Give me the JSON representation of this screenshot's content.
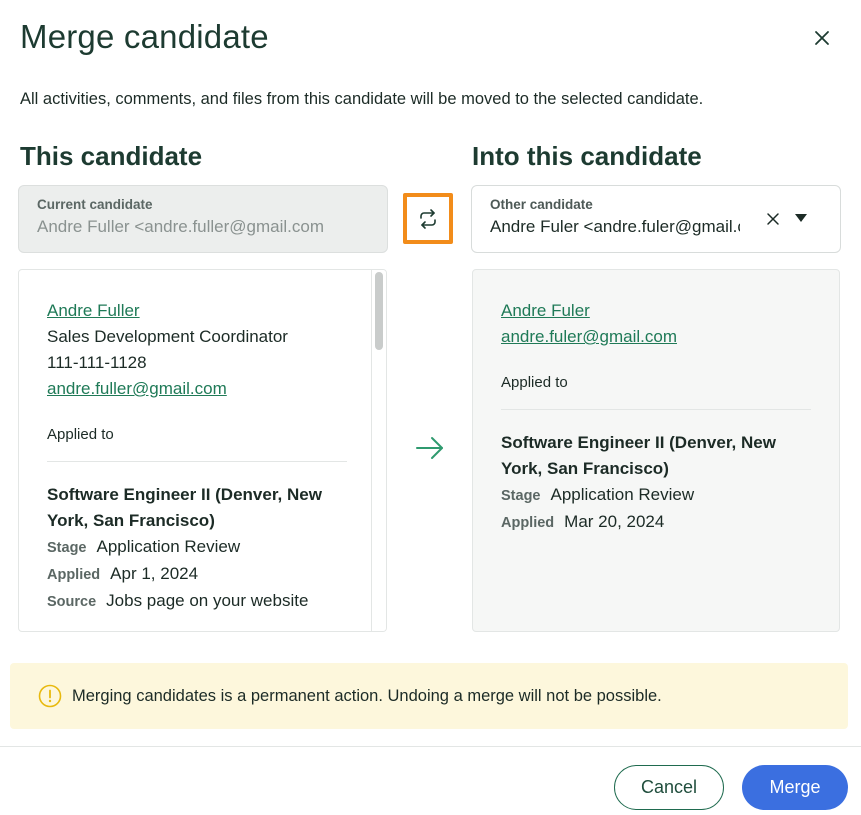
{
  "dialog": {
    "title": "Merge candidate",
    "description": "All activities, comments, and files from this candidate will be moved to the selected candidate."
  },
  "left": {
    "heading": "This candidate",
    "field_label": "Current candidate",
    "field_value": "Andre Fuller <andre.fuller@gmail.com",
    "profile": {
      "name": "Andre Fuller",
      "title": "Sales Development Coordinator",
      "phone": "111-111-1128",
      "email": "andre.fuller@gmail.com",
      "applied_to_label": "Applied to",
      "job": "Software Engineer II (Denver, New York, San Francisco)",
      "stage_label": "Stage",
      "stage": "Application Review",
      "applied_label": "Applied",
      "applied": "Apr 1, 2024",
      "source_label": "Source",
      "source": "Jobs page on your website"
    }
  },
  "right": {
    "heading": "Into this candidate",
    "field_label": "Other candidate",
    "field_value": "Andre Fuler <andre.fuler@gmail.com>",
    "profile": {
      "name": "Andre Fuler",
      "email": "andre.fuler@gmail.com",
      "applied_to_label": "Applied to",
      "job": "Software Engineer II (Denver, New York, San Francisco)",
      "stage_label": "Stage",
      "stage": "Application Review",
      "applied_label": "Applied",
      "applied": "Mar 20, 2024"
    }
  },
  "warning": {
    "text": "Merging candidates is a permanent action. Undoing a merge will not be possible."
  },
  "footer": {
    "cancel_label": "Cancel",
    "merge_label": "Merge"
  },
  "icons": {
    "close": "close-icon",
    "swap": "swap-icon",
    "clear": "clear-icon",
    "dropdown": "chevron-down-icon",
    "arrow": "arrow-right-icon",
    "warning": "warning-icon"
  },
  "colors": {
    "accent_green": "#1f7a57",
    "swap_highlight": "#f28c1a",
    "primary_button": "#3b6fe0",
    "warning_bg": "#fdf7dc",
    "warning_icon": "#e8b90e"
  }
}
